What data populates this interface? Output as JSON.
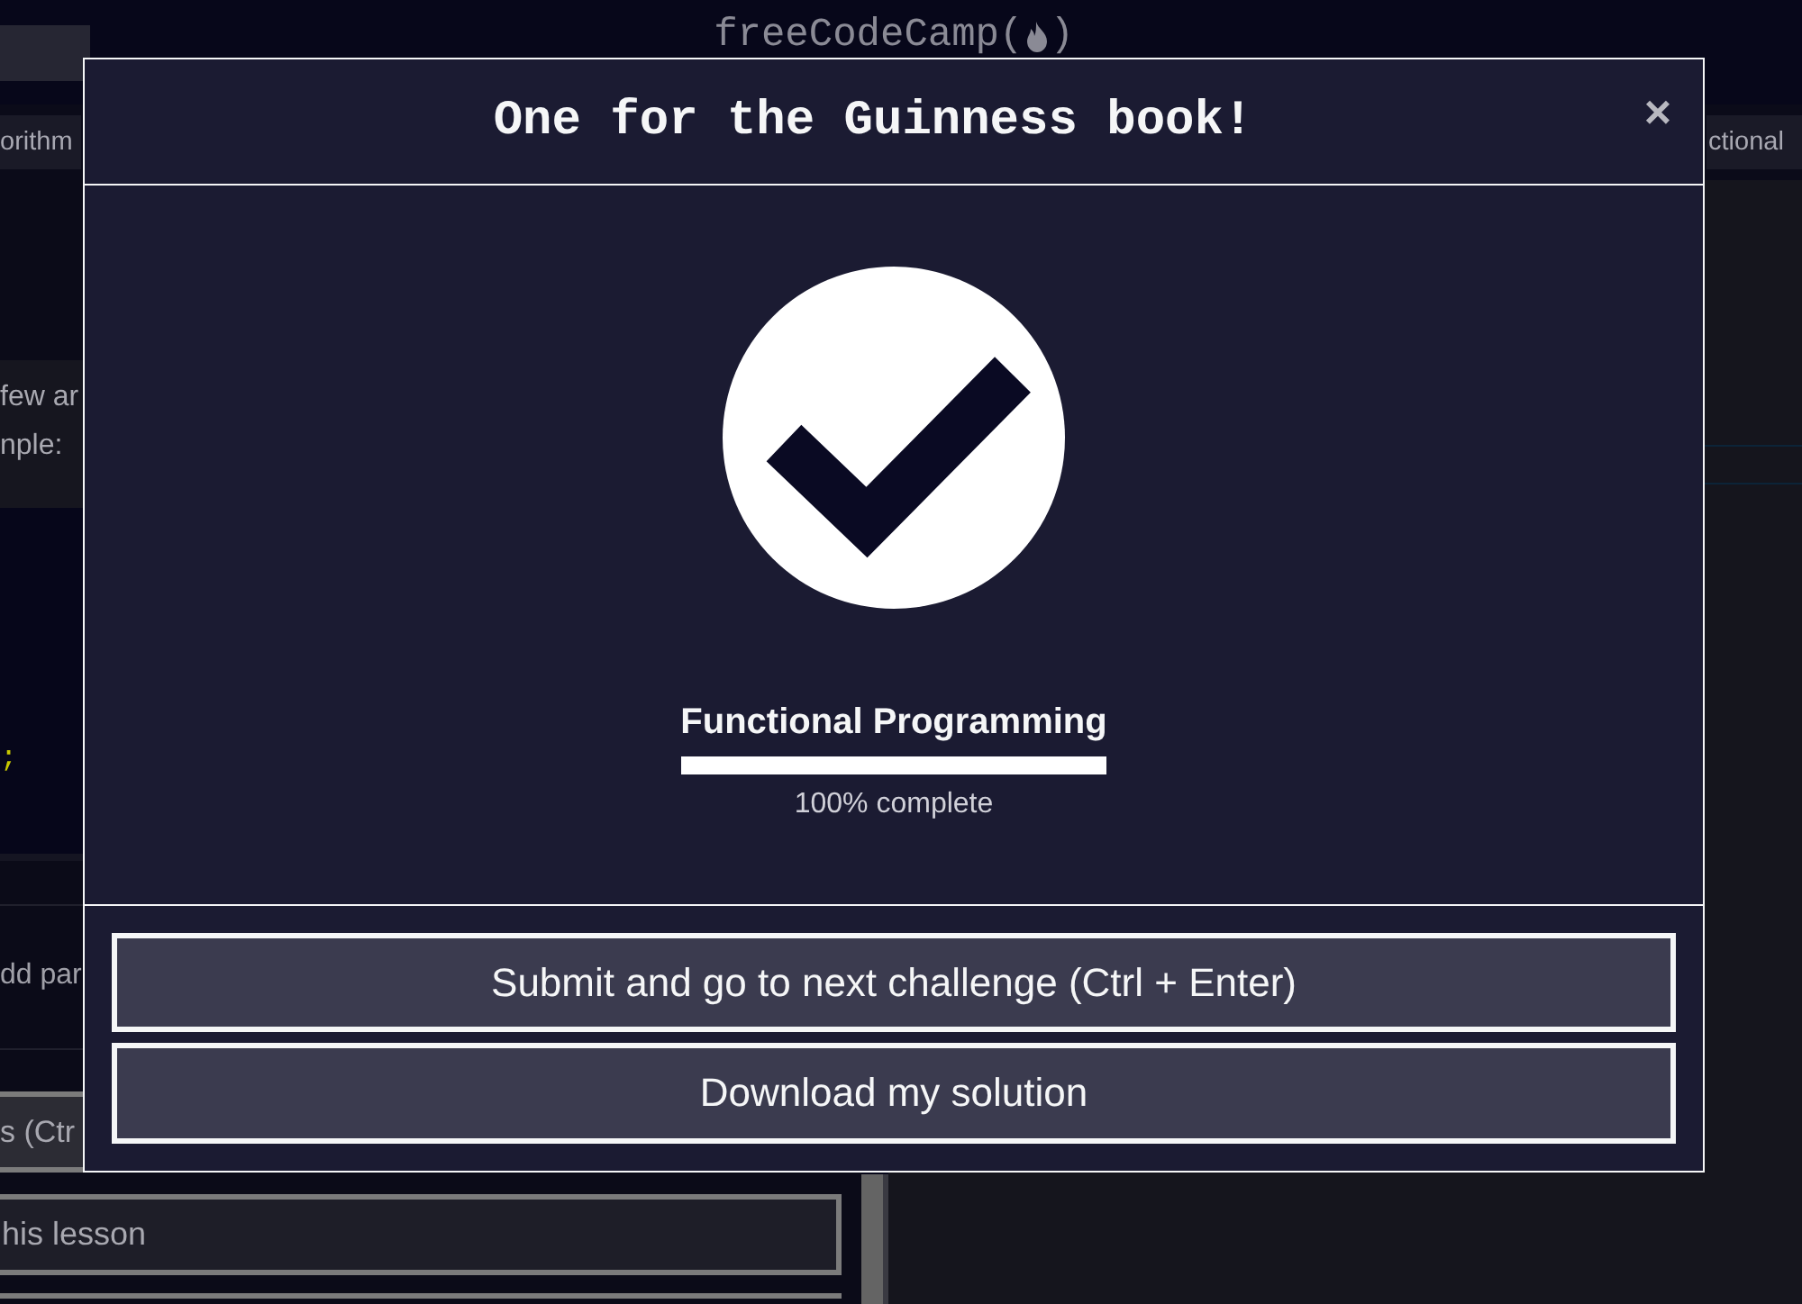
{
  "page": {
    "logo": {
      "text_before_icon": "freeCodeCamp(",
      "text_after_icon": ")"
    },
    "breadcrumbs": [
      "orithm",
      "ctional"
    ],
    "description_lines": [
      "few ar",
      "nple:"
    ],
    "code_line": ";",
    "hint_text": "dd par",
    "action_buttons": [
      "s (Ctr",
      "his lesson"
    ]
  },
  "modal": {
    "title": "One for the Guinness book!",
    "close_label": "×",
    "block_title": "Functional Programming",
    "progress": {
      "level": 1,
      "label": "100% complete"
    },
    "buttons": [
      "Submit and go to next challenge (Ctrl + Enter)",
      "Download my solution"
    ]
  }
}
